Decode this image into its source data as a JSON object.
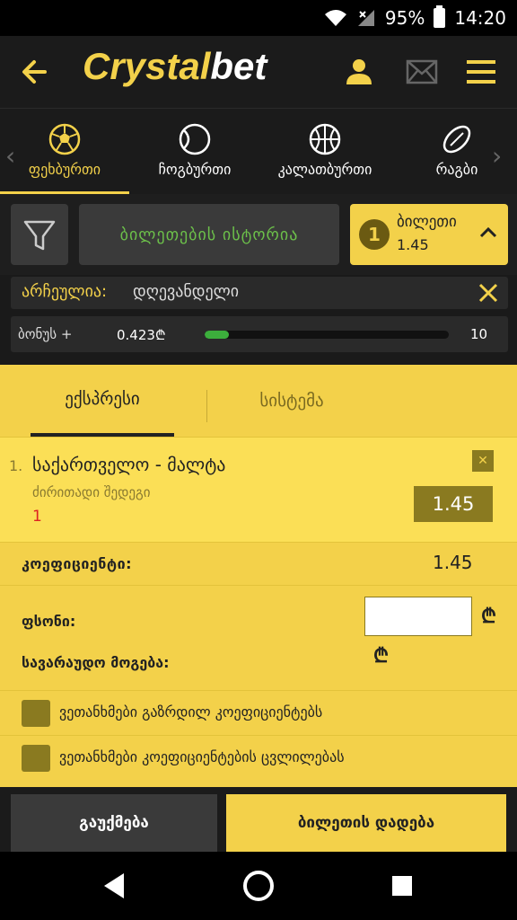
{
  "status_bar": {
    "battery": "95%",
    "time": "14:20"
  },
  "header": {
    "logo_part1": "Crystal",
    "logo_part2": "bet"
  },
  "sports": {
    "tabs": [
      {
        "label": "ფეხბურთი",
        "icon": "soccer-ball-icon",
        "active": true
      },
      {
        "label": "ჩოგბურთი",
        "icon": "tennis-ball-icon",
        "active": false
      },
      {
        "label": "კალათბურთი",
        "icon": "basketball-icon",
        "active": false
      },
      {
        "label": "რაგბი",
        "icon": "rugby-ball-icon",
        "active": false
      }
    ]
  },
  "toolbar": {
    "history_label": "ბილეთების ისტორია",
    "ticket_count": "1",
    "ticket_label": "ბილეთი",
    "ticket_odds": "1.45"
  },
  "selected": {
    "label": "არჩეულია:",
    "value": "დღევანდელი"
  },
  "bonus": {
    "label": "ბონუს +",
    "amount": "0.423₾",
    "max": "10",
    "progress": 0.1
  },
  "betslip": {
    "tabs": [
      {
        "label": "ექსპრესი",
        "active": true
      },
      {
        "label": "სისტემა",
        "active": false
      }
    ],
    "selection": {
      "number": "1.",
      "match": "საქართველო - მალტა",
      "market": "ძირითადი შედეგი",
      "outcome": "1",
      "odds": "1.45"
    },
    "coefficient_label": "კოეფიციენტი:",
    "coefficient_value": "1.45",
    "stake_label": "ფსონი:",
    "stake_value": "",
    "currency_symbol": "₾",
    "possible_win_label": "სავარაუდო მოგება:",
    "checkbox_increased_odds": "ვეთანხმები გაზრდილ კოეფიციენტებს",
    "checkbox_odds_change": "ვეთანხმები კოეფიციენტების ცვლილებას"
  },
  "buttons": {
    "cancel": "გაუქმება",
    "place_bet": "ბილეთის დადება"
  },
  "colors": {
    "accent": "#f3d14a",
    "dark": "#1b1b1b",
    "green": "#6cc04a",
    "red": "#dd2222"
  }
}
